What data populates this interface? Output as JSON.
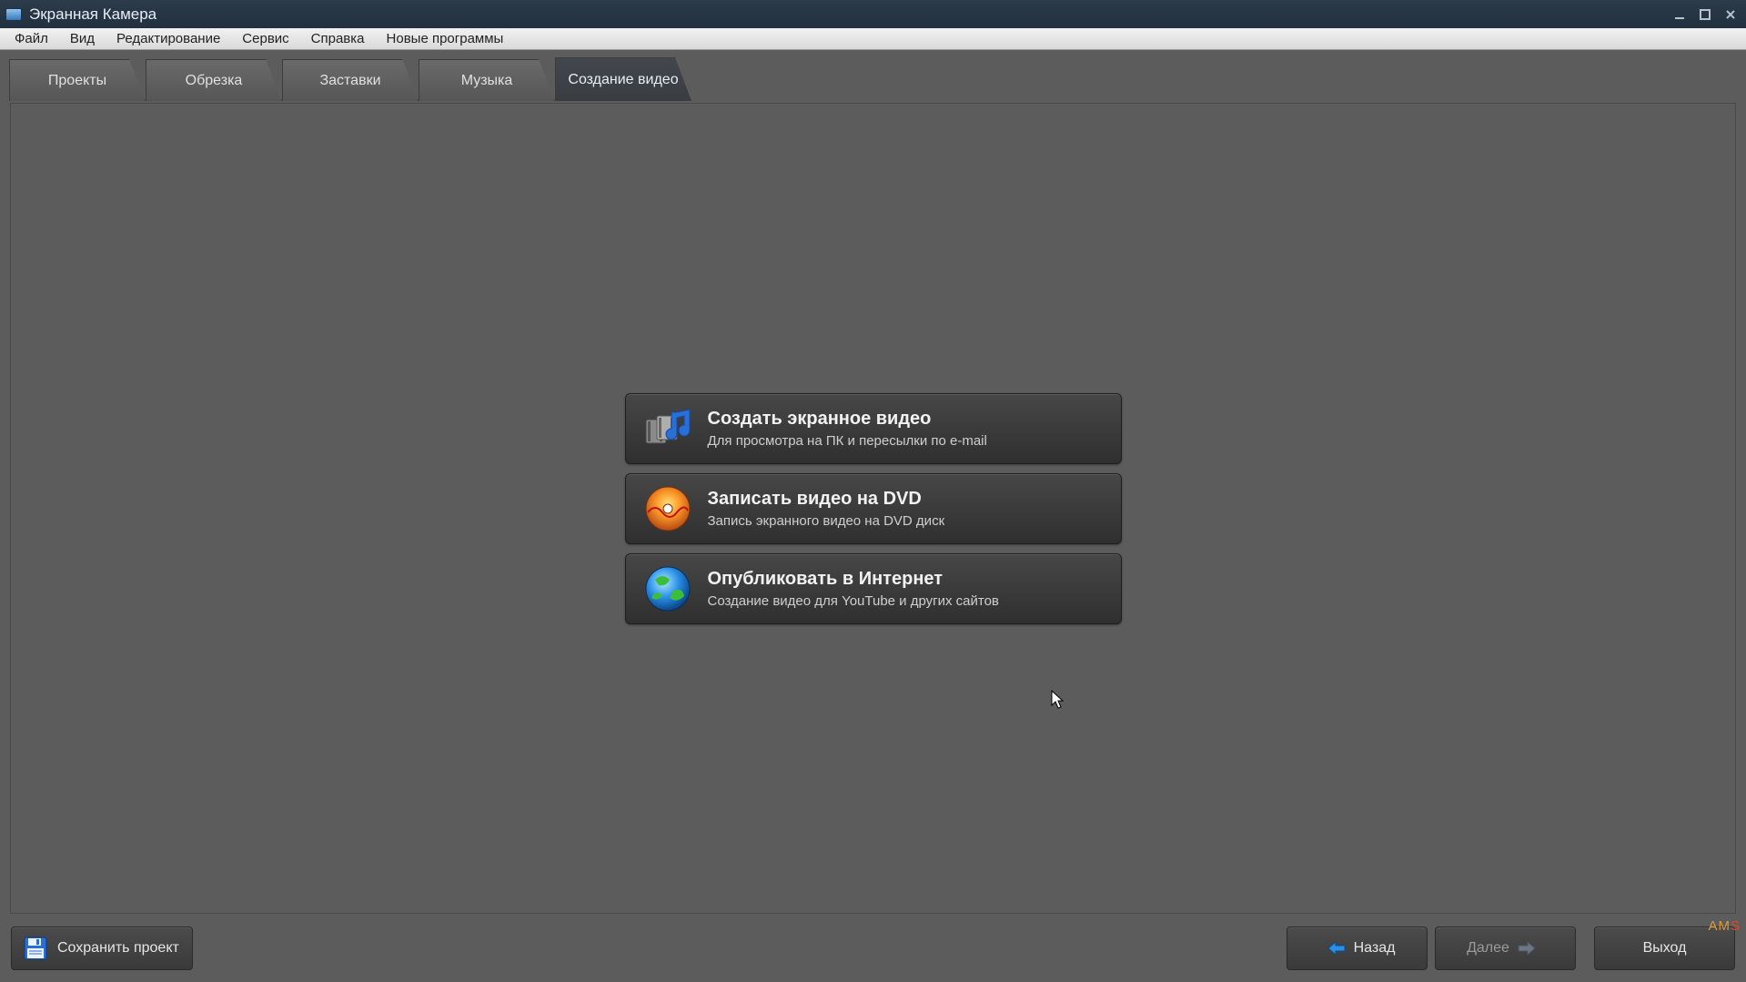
{
  "window": {
    "title": "Экранная Камера"
  },
  "menu": {
    "file": "Файл",
    "view": "Вид",
    "edit": "Редактирование",
    "service": "Сервис",
    "help": "Справка",
    "new_programs": "Новые программы"
  },
  "tabs": {
    "projects": "Проекты",
    "crop": "Обрезка",
    "intros": "Заставки",
    "music": "Музыка",
    "create": "Создание видео"
  },
  "options": {
    "screenvideo": {
      "title": "Создать экранное видео",
      "desc": "Для просмотра на ПК и пересылки по e-mail"
    },
    "dvd": {
      "title": "Записать видео на DVD",
      "desc": "Запись экранного видео на DVD диск"
    },
    "publish": {
      "title": "Опубликовать в Интернет",
      "desc": "Создание видео для YouTube и других сайтов"
    }
  },
  "bottom": {
    "save": "Сохранить проект",
    "back": "Назад",
    "next": "Далее",
    "exit": "Выход"
  },
  "brand": {
    "am": "AM",
    "s": "S"
  }
}
